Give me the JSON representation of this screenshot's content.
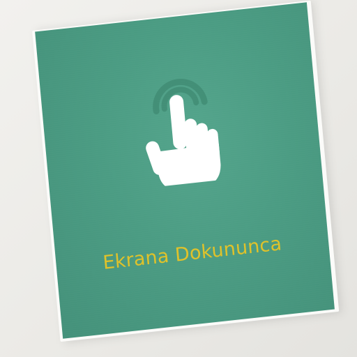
{
  "card": {
    "caption": "Ekrana Dokununca",
    "icon": "touch-hand-icon"
  },
  "colors": {
    "card_green": "#4b9c83",
    "caption_yellow": "#e0c22a",
    "hand_white": "#ffffff",
    "ripple_green": "#3f8a72",
    "background": "#eeede9"
  }
}
